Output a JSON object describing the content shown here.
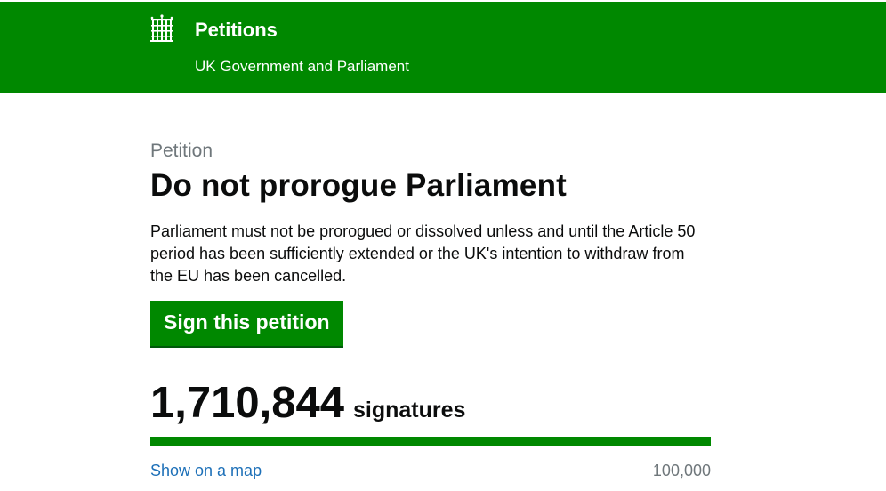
{
  "header": {
    "title": "Petitions",
    "subtitle": "UK Government and Parliament",
    "logo_icon": "portcullis-icon",
    "background_color": "#008800"
  },
  "petition": {
    "eyebrow": "Petition",
    "title": "Do not prorogue Parliament",
    "description": "Parliament must not be prorogued or dissolved unless and until the Article 50 period has been sufficiently extended or the UK's intention to withdraw from the EU has been cancelled.",
    "sign_button_label": "Sign this petition"
  },
  "signatures": {
    "count": "1,710,844",
    "label": "signatures",
    "progress_fraction": 1.0,
    "target": "100,000",
    "map_link": "Show on a map"
  },
  "colors": {
    "accent": "#008800",
    "link": "#1d70b8",
    "muted": "#6f777b"
  }
}
